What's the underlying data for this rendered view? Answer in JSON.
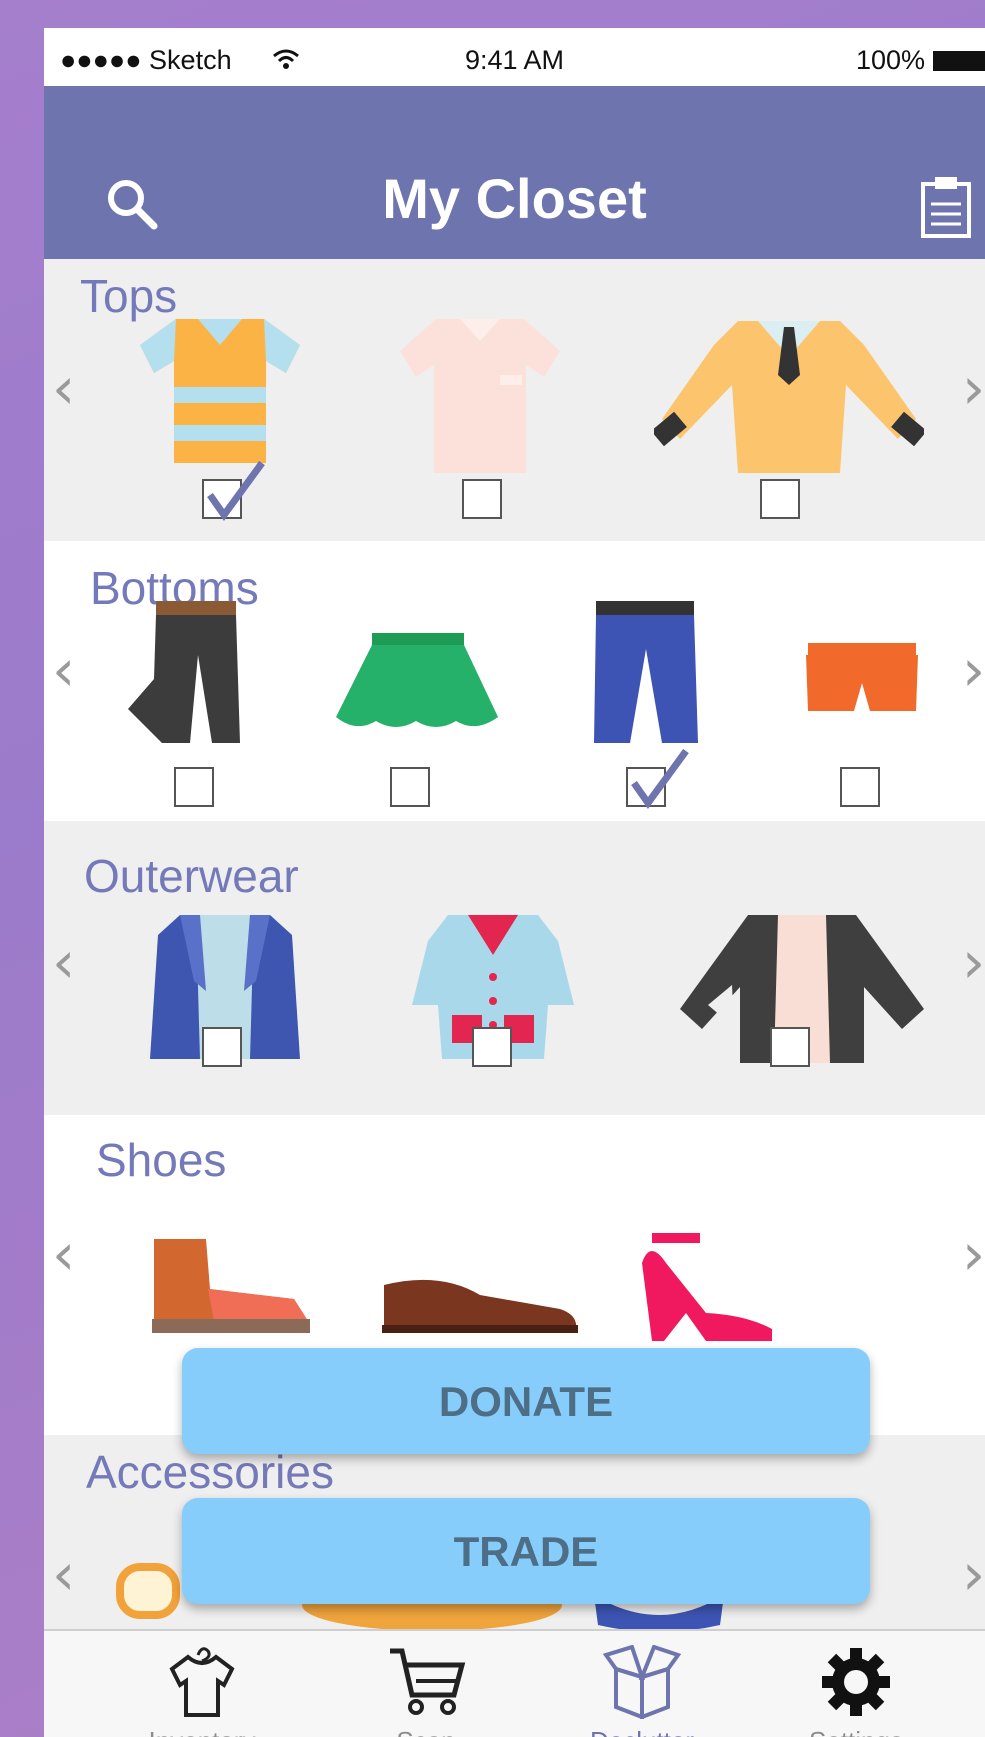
{
  "status_bar": {
    "carrier": "●●●●● Sketch",
    "time": "9:41 AM",
    "battery": "100%"
  },
  "nav": {
    "title": "My Closet",
    "left_icon": "search-icon",
    "right_icon": "clipboard-icon"
  },
  "sections": [
    {
      "label": "Tops",
      "items": [
        {
          "name": "striped-polo-shirt",
          "checked": true
        },
        {
          "name": "pink-shirt",
          "checked": false
        },
        {
          "name": "yellow-sweater-with-tie",
          "checked": false
        }
      ]
    },
    {
      "label": "Bottoms",
      "items": [
        {
          "name": "black-pants",
          "checked": false
        },
        {
          "name": "green-skirt",
          "checked": false
        },
        {
          "name": "blue-jeans",
          "checked": true
        },
        {
          "name": "orange-shorts",
          "checked": false
        }
      ]
    },
    {
      "label": "Outerwear",
      "items": [
        {
          "name": "blue-blazer",
          "checked": false
        },
        {
          "name": "light-blue-coat",
          "checked": false
        },
        {
          "name": "black-jacket",
          "checked": false
        }
      ]
    },
    {
      "label": "Shoes",
      "items": [
        {
          "name": "brown-boot"
        },
        {
          "name": "brown-oxford"
        },
        {
          "name": "red-high-heel"
        }
      ]
    },
    {
      "label": "Accessories",
      "items": [
        {
          "name": "sunglasses"
        },
        {
          "name": "hat"
        },
        {
          "name": "bow-tie"
        }
      ]
    }
  ],
  "actions": {
    "donate": "DONATE",
    "trade": "TRADE"
  },
  "tabs": [
    {
      "label": "Inventory",
      "icon": "shirt-icon",
      "active": false
    },
    {
      "label": "Scan",
      "icon": "cart-icon",
      "active": false
    },
    {
      "label": "Declutter",
      "icon": "box-icon",
      "active": true
    },
    {
      "label": "Settings",
      "icon": "gear-icon",
      "active": false
    }
  ],
  "colors": {
    "nav_bar": "#6e74ae",
    "section_label": "#7479b9",
    "button": "#87cdfb",
    "button_text": "#4e6e86",
    "check": "#6e74ae"
  }
}
